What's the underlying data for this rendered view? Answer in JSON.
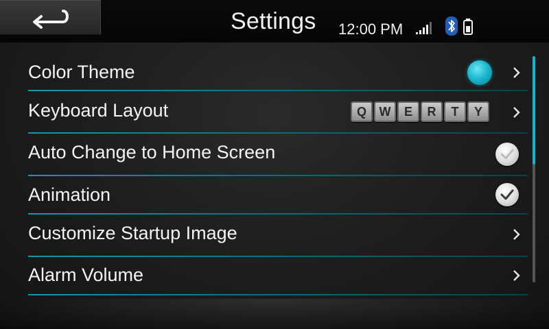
{
  "header": {
    "title": "Settings",
    "back_icon": "return-arrow-icon",
    "clock": "12:00 PM",
    "status_icons": [
      "signal-icon",
      "bluetooth-icon",
      "battery-icon"
    ]
  },
  "settings": [
    {
      "label": "Color Theme",
      "control": "color-dot",
      "value_color": "#1cb9cf",
      "has_chevron": true
    },
    {
      "label": "Keyboard Layout",
      "control": "keycaps",
      "keys": [
        "Q",
        "W",
        "E",
        "R",
        "T",
        "Y"
      ],
      "has_chevron": true
    },
    {
      "label": "Auto Change to Home Screen",
      "control": "checkbox",
      "checked": false
    },
    {
      "label": "Animation",
      "control": "checkbox",
      "checked": true
    },
    {
      "label": "Customize Startup Image",
      "control": "none",
      "has_chevron": true
    },
    {
      "label": "Alarm Volume",
      "control": "none",
      "has_chevron": true
    }
  ],
  "scroll": {
    "position": 0.0,
    "visible_fraction": 0.48
  },
  "colors": {
    "accent": "#19b3c9",
    "background": "#1c1c1c",
    "text": "#f4f4f4"
  }
}
